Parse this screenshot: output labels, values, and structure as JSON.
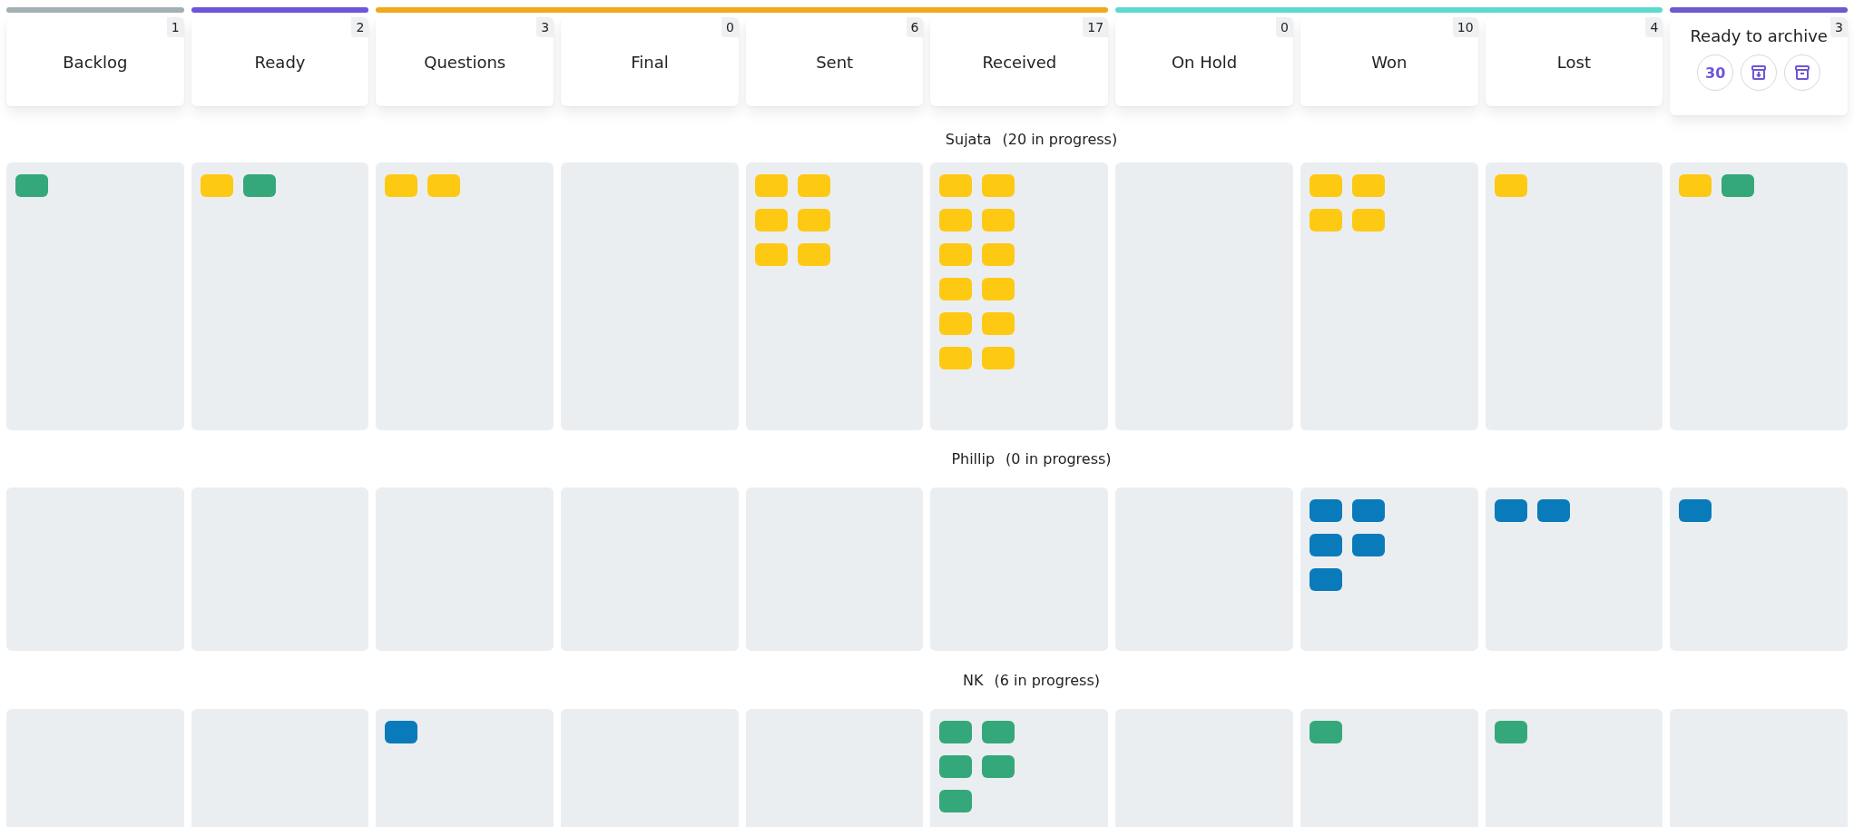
{
  "stages": [
    {
      "color": "#a3b0b3",
      "columns": [
        {
          "kind": "normal",
          "title": "Backlog",
          "count": "1"
        }
      ]
    },
    {
      "color": "#6f55d8",
      "columns": [
        {
          "kind": "normal",
          "title": "Ready",
          "count": "2"
        }
      ]
    },
    {
      "color": "#f2a81d",
      "columns": [
        {
          "kind": "normal",
          "title": "Questions",
          "count": "3"
        },
        {
          "kind": "normal",
          "title": "Final",
          "count": "0"
        },
        {
          "kind": "normal",
          "title": "Sent",
          "count": "6"
        },
        {
          "kind": "normal",
          "title": "Received",
          "count": "17"
        }
      ]
    },
    {
      "color": "#5dd9cf",
      "columns": [
        {
          "kind": "normal",
          "title": "On Hold",
          "count": "0"
        },
        {
          "kind": "normal",
          "title": "Won",
          "count": "10"
        },
        {
          "kind": "normal",
          "title": "Lost",
          "count": "4"
        }
      ]
    },
    {
      "color": "#6b5bcc",
      "columns": [
        {
          "kind": "archive",
          "title": "Ready to archive",
          "count": "3",
          "archived": "30"
        }
      ]
    }
  ],
  "lanes": [
    {
      "name": "Sujata",
      "summary": "(20 in progress)",
      "cells": [
        [
          {
            "color": "#34a87a"
          }
        ],
        [
          {
            "color": "#fdc913"
          },
          {
            "color": "#34a87a"
          }
        ],
        [
          {
            "color": "#fdc913"
          },
          {
            "color": "#fdc913"
          }
        ],
        [],
        [
          {
            "color": "#fdc913"
          },
          {
            "color": "#fdc913"
          },
          {
            "color": "#fdc913"
          },
          {
            "color": "#fdc913"
          },
          {
            "color": "#fdc913"
          },
          {
            "color": "#fdc913"
          }
        ],
        [
          {
            "color": "#fdc913"
          },
          {
            "color": "#fdc913"
          },
          {
            "color": "#fdc913"
          },
          {
            "color": "#fdc913"
          },
          {
            "color": "#fdc913"
          },
          {
            "color": "#fdc913"
          },
          {
            "color": "#fdc913"
          },
          {
            "color": "#fdc913"
          },
          {
            "color": "#fdc913"
          },
          {
            "color": "#fdc913"
          },
          {
            "color": "#fdc913"
          },
          {
            "color": "#fdc913"
          }
        ],
        [],
        [
          {
            "color": "#fdc913"
          },
          {
            "color": "#fdc913"
          },
          {
            "color": "#fdc913"
          },
          {
            "color": "#fdc913"
          }
        ],
        [
          {
            "color": "#fdc913"
          }
        ],
        [
          {
            "color": "#fdc913"
          },
          {
            "color": "#34a87a"
          }
        ]
      ]
    },
    {
      "name": "Phillip",
      "summary": "(0 in progress)",
      "cells": [
        [],
        [],
        [],
        [],
        [],
        [],
        [],
        [
          {
            "color": "#0a7bba"
          },
          {
            "color": "#0a7bba"
          },
          {
            "color": "#0a7bba"
          },
          {
            "color": "#0a7bba"
          },
          {
            "color": "#0a7bba"
          }
        ],
        [
          {
            "color": "#0a7bba"
          },
          {
            "color": "#0a7bba"
          }
        ],
        [
          {
            "color": "#0a7bba"
          }
        ]
      ]
    },
    {
      "name": "NK",
      "summary": "(6 in progress)",
      "cells": [
        [],
        [],
        [
          {
            "color": "#0a7bba"
          }
        ],
        [],
        [],
        [
          {
            "color": "#34a87a"
          },
          {
            "color": "#34a87a"
          },
          {
            "color": "#34a87a"
          },
          {
            "color": "#34a87a"
          },
          {
            "color": "#34a87a"
          }
        ],
        [],
        [
          {
            "color": "#34a87a"
          }
        ],
        [
          {
            "color": "#34a87a"
          }
        ],
        []
      ]
    }
  ]
}
